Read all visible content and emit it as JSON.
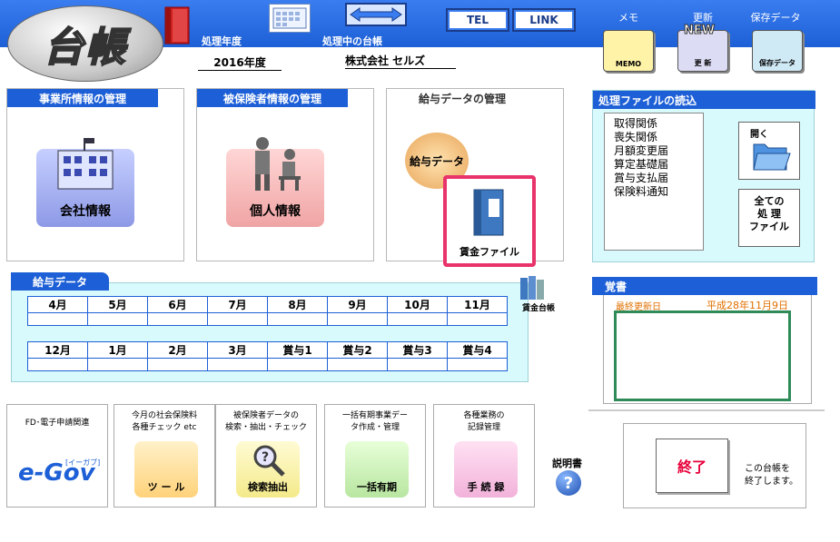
{
  "header": {
    "logo": "台帳",
    "year_label": "処理年度",
    "year_value": "2016年度",
    "ledger_label": "処理中の台帳",
    "company": "株式会社 セルズ",
    "tel": "TEL",
    "link": "LINK",
    "tools": [
      {
        "top": "メモ",
        "icon": "MEMO"
      },
      {
        "top": "更新",
        "icon": "更 新"
      },
      {
        "top": "保存データ",
        "icon": "保存データ"
      }
    ],
    "new_badge": "NEW"
  },
  "panels": {
    "office": {
      "title": "事業所情報の管理",
      "button": "会社情報"
    },
    "insured": {
      "title": "被保険者情報の管理",
      "button": "個人情報"
    },
    "salary": {
      "title": "給与データの管理",
      "button": "給与データ",
      "highlight": "賃金ファイル"
    }
  },
  "files": {
    "title": "処理ファイルの読込",
    "items": [
      "取得関係",
      "喪失関係",
      "月額変更届",
      "算定基礎届",
      "賞与支払届",
      "保険料通知"
    ],
    "open_label": "開く",
    "all_label_1": "全ての",
    "all_label_2": "処 理",
    "all_label_3": "ファイル"
  },
  "salary_grid": {
    "title": "給与データ",
    "row1": [
      "4月",
      "5月",
      "6月",
      "7月",
      "8月",
      "9月",
      "10月",
      "11月"
    ],
    "row2": [
      "12月",
      "1月",
      "2月",
      "3月",
      "賞与1",
      "賞与2",
      "賞与3",
      "賞与4"
    ],
    "ledger_icon_label": "賃金台帳"
  },
  "notes": {
    "title": "覚書",
    "last_updated_label": "最終更新日",
    "last_updated_value": "平成28年11月9日"
  },
  "bottom": {
    "cards": [
      {
        "text": "FD･電子申請関連",
        "icon": "e-Gov",
        "icon_sub": "[イーガブ]"
      },
      {
        "text": "今月の社会保険料\n各種チェック etc",
        "icon": "ツ ー ル"
      },
      {
        "text": "被保険者データの\n検索・抽出・チェック",
        "icon": "検索抽出"
      },
      {
        "text": "一括有期事業デー\nタ作成・管理",
        "icon": "一括有期"
      },
      {
        "text": "各種業務の\n記録管理",
        "icon": "手 続 録"
      }
    ],
    "manual": "説明書",
    "exit": "終了",
    "exit_note": "この台帳を\n終了します。"
  },
  "colors": {
    "accent": "#1d5fd6",
    "highlight": "#e8336b"
  }
}
